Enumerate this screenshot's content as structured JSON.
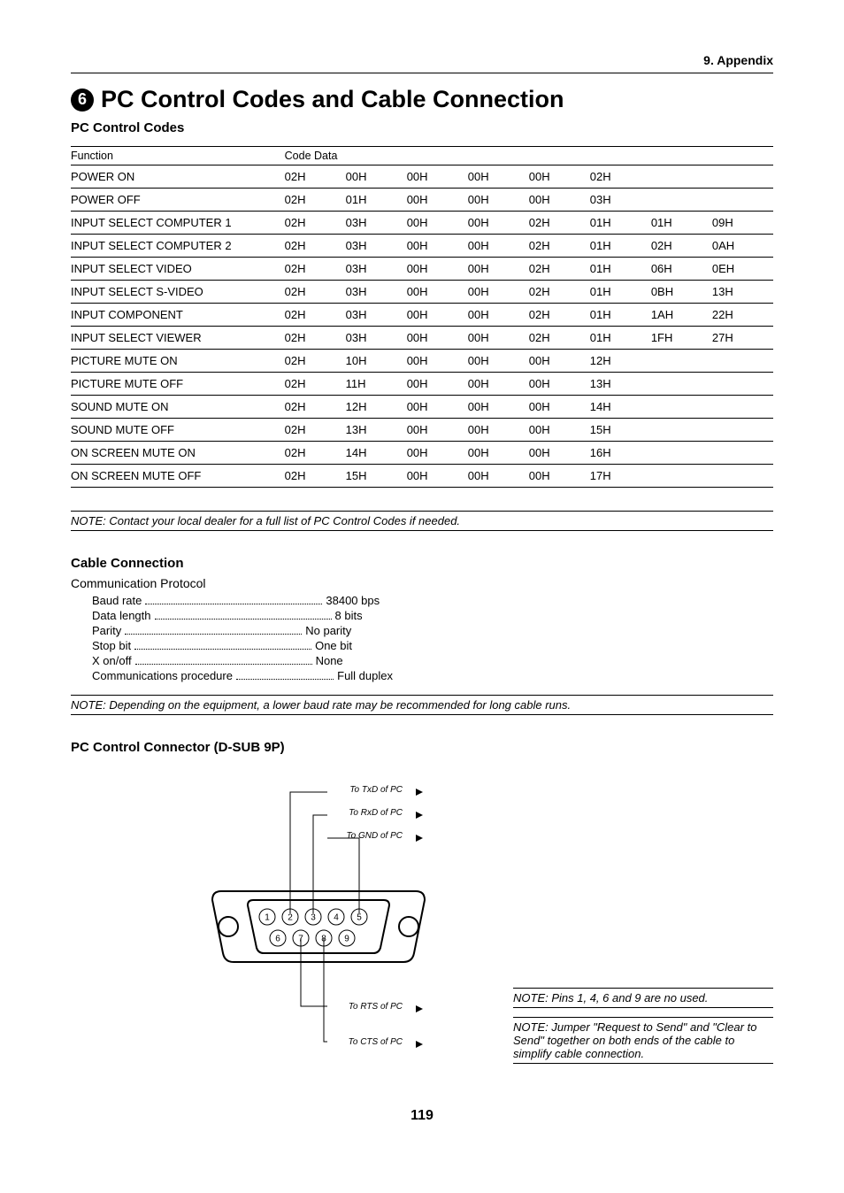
{
  "header": {
    "right": "9. Appendix"
  },
  "section": {
    "bullet_num": "6",
    "title": "PC Control Codes and Cable Connection"
  },
  "codes_heading": "PC Control Codes",
  "codes_table": {
    "headers": [
      "Function",
      "Code Data"
    ],
    "rows": [
      {
        "fn": "POWER ON",
        "d": [
          "02H",
          "00H",
          "00H",
          "00H",
          "00H",
          "02H",
          "",
          ""
        ]
      },
      {
        "fn": "POWER OFF",
        "d": [
          "02H",
          "01H",
          "00H",
          "00H",
          "00H",
          "03H",
          "",
          ""
        ]
      },
      {
        "fn": "INPUT SELECT COMPUTER 1",
        "d": [
          "02H",
          "03H",
          "00H",
          "00H",
          "02H",
          "01H",
          "01H",
          "09H"
        ]
      },
      {
        "fn": "INPUT SELECT COMPUTER 2",
        "d": [
          "02H",
          "03H",
          "00H",
          "00H",
          "02H",
          "01H",
          "02H",
          "0AH"
        ]
      },
      {
        "fn": "INPUT SELECT VIDEO",
        "d": [
          "02H",
          "03H",
          "00H",
          "00H",
          "02H",
          "01H",
          "06H",
          "0EH"
        ]
      },
      {
        "fn": "INPUT SELECT S-VIDEO",
        "d": [
          "02H",
          "03H",
          "00H",
          "00H",
          "02H",
          "01H",
          "0BH",
          "13H"
        ]
      },
      {
        "fn": "INPUT COMPONENT",
        "d": [
          "02H",
          "03H",
          "00H",
          "00H",
          "02H",
          "01H",
          "1AH",
          "22H"
        ]
      },
      {
        "fn": "INPUT SELECT VIEWER",
        "d": [
          "02H",
          "03H",
          "00H",
          "00H",
          "02H",
          "01H",
          "1FH",
          "27H"
        ]
      },
      {
        "fn": "PICTURE MUTE ON",
        "d": [
          "02H",
          "10H",
          "00H",
          "00H",
          "00H",
          "12H",
          "",
          ""
        ]
      },
      {
        "fn": "PICTURE MUTE OFF",
        "d": [
          "02H",
          "11H",
          "00H",
          "00H",
          "00H",
          "13H",
          "",
          ""
        ]
      },
      {
        "fn": "SOUND MUTE ON",
        "d": [
          "02H",
          "12H",
          "00H",
          "00H",
          "00H",
          "14H",
          "",
          ""
        ]
      },
      {
        "fn": "SOUND MUTE OFF",
        "d": [
          "02H",
          "13H",
          "00H",
          "00H",
          "00H",
          "15H",
          "",
          ""
        ]
      },
      {
        "fn": "ON SCREEN MUTE ON",
        "d": [
          "02H",
          "14H",
          "00H",
          "00H",
          "00H",
          "16H",
          "",
          ""
        ]
      },
      {
        "fn": "ON SCREEN MUTE OFF",
        "d": [
          "02H",
          "15H",
          "00H",
          "00H",
          "00H",
          "17H",
          "",
          ""
        ]
      }
    ]
  },
  "note1": "NOTE: Contact your local dealer for a full list of PC Control Codes if needed.",
  "cable_heading": "Cable Connection",
  "protocol_sub": "Communication Protocol",
  "protocol": [
    {
      "k": "Baud rate",
      "v": "38400 bps"
    },
    {
      "k": "Data length",
      "v": "8 bits"
    },
    {
      "k": "Parity",
      "v": "No parity"
    },
    {
      "k": "Stop bit",
      "v": "One bit"
    },
    {
      "k": "X on/off",
      "v": "None"
    },
    {
      "k": "Communications procedure",
      "v": "Full duplex"
    }
  ],
  "note2": "NOTE: Depending on the equipment, a lower baud rate may be recommended for long cable runs.",
  "connector_heading": "PC Control Connector (D-SUB 9P)",
  "diagram_labels": {
    "txd": "To TxD of PC",
    "rxd": "To RxD of PC",
    "gnd": "To GND of PC",
    "rts": "To RTS of PC",
    "cts": "To CTS of PC"
  },
  "note3": "NOTE: Pins 1, 4, 6 and 9 are no used.",
  "note4": "NOTE: Jumper \"Request to Send\" and \"Clear to Send\" together on both ends of the cable to simplify cable connection.",
  "page_number": "119"
}
